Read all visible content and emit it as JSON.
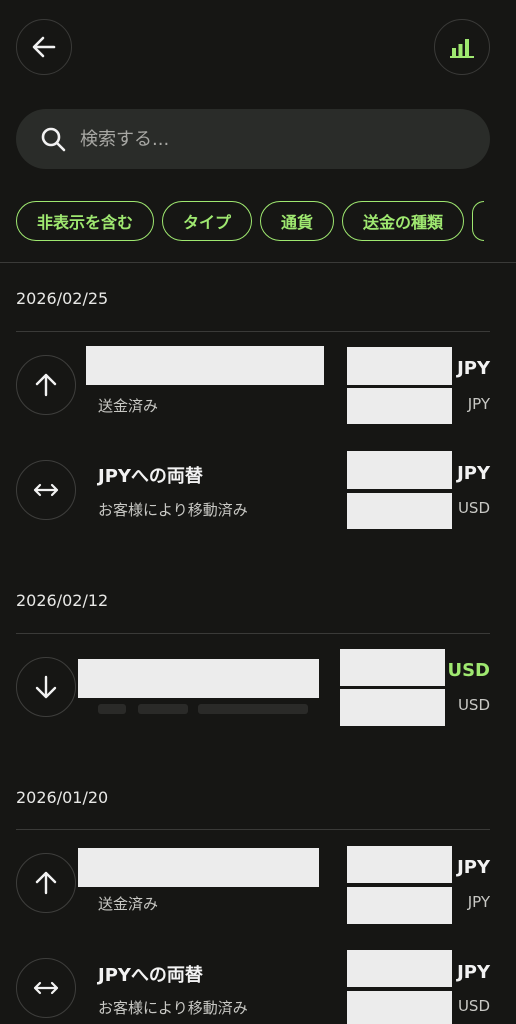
{
  "header": {
    "back_icon": "arrow-left-icon",
    "stats_icon": "bar-chart-icon",
    "accent": "#9fe870"
  },
  "search": {
    "placeholder": "検索する..."
  },
  "filters": [
    "非表示を含む",
    "タイプ",
    "通貨",
    "送金の種類"
  ],
  "groups": [
    {
      "date": "2026/02/25",
      "transactions": [
        {
          "icon": "arrow-up-icon",
          "title": "",
          "subtitle": "送金済み",
          "amount": "JPY",
          "amount_sub": "JPY"
        },
        {
          "icon": "exchange-arrows-icon",
          "title": "JPYへの両替",
          "subtitle": "お客様により移動済み",
          "amount": "JPY",
          "amount_sub": "USD"
        }
      ]
    },
    {
      "date": "2026/02/12",
      "transactions": [
        {
          "icon": "arrow-down-icon",
          "title": "",
          "subtitle": "",
          "amount": "USD",
          "amount_sub": "USD"
        }
      ]
    },
    {
      "date": "2026/01/20",
      "transactions": [
        {
          "icon": "arrow-up-icon",
          "title": "",
          "subtitle": "送金済み",
          "amount": "JPY",
          "amount_sub": "JPY"
        },
        {
          "icon": "exchange-arrows-icon",
          "title": "JPYへの両替",
          "subtitle": "お客様により移動済み",
          "amount": "JPY",
          "amount_sub": "USD"
        }
      ]
    }
  ]
}
